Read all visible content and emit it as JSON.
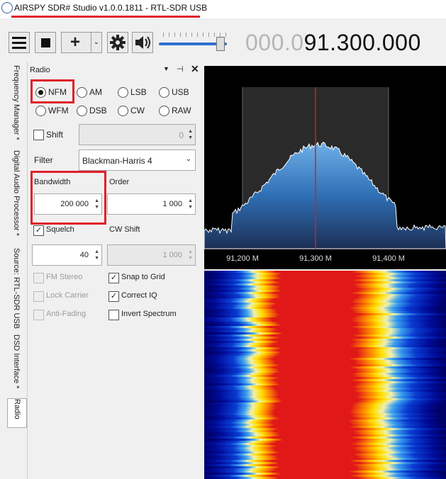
{
  "window": {
    "title": "AIRSPY SDR# Studio v1.0.0.1811 - RTL-SDR USB"
  },
  "toolbar": {
    "frequency_dim": "000.0",
    "frequency_bright": "91.300.000"
  },
  "side_tabs": [
    {
      "label": "Frequency Manager *"
    },
    {
      "label": "Digital Audio Processor *"
    },
    {
      "label": "Source: RTL-SDR USB"
    },
    {
      "label": "DSD Interface *"
    },
    {
      "label": "Radio"
    }
  ],
  "radio_panel": {
    "title": "Radio",
    "modes": [
      "NFM",
      "AM",
      "LSB",
      "USB",
      "WFM",
      "DSB",
      "CW",
      "RAW"
    ],
    "selected_mode": "NFM",
    "shift_label": "Shift",
    "shift_value": "0",
    "filter_label": "Filter",
    "filter_value": "Blackman-Harris 4",
    "bandwidth_label": "Bandwidth",
    "bandwidth_value": "200 000",
    "order_label": "Order",
    "order_value": "1 000",
    "squelch_label": "Squelch",
    "squelch_value": "40",
    "cw_shift_label": "CW Shift",
    "cw_shift_value": "1 000",
    "fm_stereo_label": "FM Stereo",
    "lock_carrier_label": "Lock Carrier",
    "anti_fading_label": "Anti-Fading",
    "snap_to_grid_label": "Snap to Grid",
    "correct_iq_label": "Correct IQ",
    "invert_spectrum_label": "Invert Spectrum"
  },
  "spectrum": {
    "axis_labels": [
      "91,200 M",
      "91,300 M",
      "91,400 M"
    ]
  }
}
